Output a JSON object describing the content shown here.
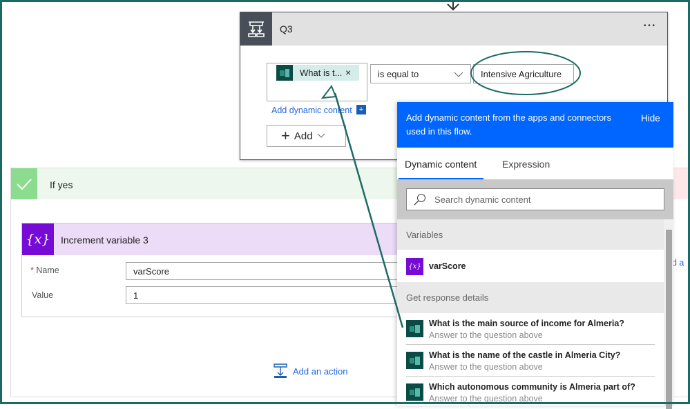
{
  "condition": {
    "title": "Q3",
    "more_label": "• • •",
    "token_label": "What is t...",
    "token_remove": "×",
    "operator": "is equal to",
    "value": "Intensive Agriculture",
    "add_dynamic_label": "Add dynamic content",
    "add_button_label": "Add"
  },
  "if_yes": {
    "title": "If yes",
    "action": {
      "title": "Increment variable 3",
      "name_label": "Name",
      "required_mark": "*",
      "name_value": "varScore",
      "value_label": "Value",
      "value_value": "1"
    },
    "add_action_label": "Add an action"
  },
  "if_no_partial_label": "dd a",
  "panel": {
    "header_text": "Add dynamic content from the apps and connectors used in this flow.",
    "hide_label": "Hide",
    "tabs": [
      {
        "label": "Dynamic content",
        "active": true
      },
      {
        "label": "Expression",
        "active": false
      }
    ],
    "search_placeholder": "Search dynamic content",
    "sections": [
      {
        "title": "Variables",
        "items": [
          {
            "title": "varScore"
          }
        ]
      },
      {
        "title": "Get response details",
        "items": [
          {
            "title": "What is the main source of income for Almeria?",
            "subtitle": "Answer to the question above"
          },
          {
            "title": "What is the name of the castle in Almeria City?",
            "subtitle": "Answer to the question above"
          },
          {
            "title": "Which autonomous community is Almeria part of?",
            "subtitle": "Answer to the question above"
          }
        ]
      }
    ]
  },
  "colors": {
    "accent_blue": "#0066ff",
    "variable_purple": "#770bd6",
    "forms_teal": "#0b4b45",
    "annotation": "#1b6a63",
    "success_green": "#8bdc8f"
  }
}
